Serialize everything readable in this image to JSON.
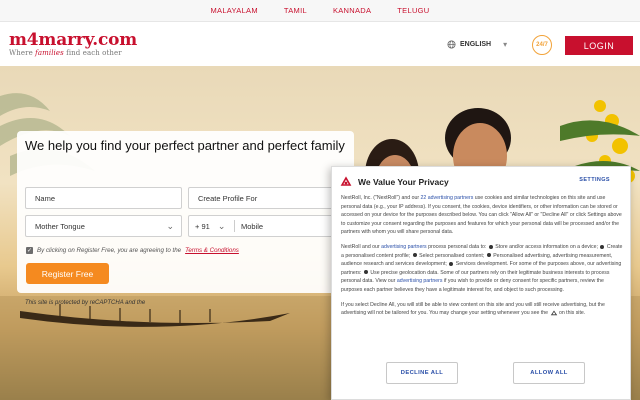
{
  "languages": [
    "MALAYALAM",
    "TAMIL",
    "KANNADA",
    "TELUGU"
  ],
  "header": {
    "logo": "m4marry.com",
    "tagline_pre": "Where ",
    "tagline_em": "families",
    "tagline_post": " find each other",
    "language": "ENGLISH",
    "support_label": "24/7",
    "login_label": "LOGIN"
  },
  "registration": {
    "title": "We help you find your perfect partner and perfect family",
    "name_placeholder": "Name",
    "profile_for_placeholder": "Create Profile For",
    "mother_tongue_placeholder": "Mother Tongue",
    "country_code": "+ 91",
    "mobile_placeholder": "Mobile",
    "consent_pre": "By clicking on Register Free, you are agreeing to the",
    "consent_link": "Terms & Conditions",
    "register_label": "Register Free",
    "recaptcha_note": "This site is protected by reCAPTCHA and the"
  },
  "privacy_modal": {
    "title": "We Value Your Privacy",
    "settings_label": "SETTINGS",
    "p1_a": "NextRoll, Inc. (\"NextRoll\") and our",
    "p1_link": "22 advertising partners",
    "p1_b": "use cookies and similar technologies on this site and use personal data (e.g., your IP address). If you consent, the cookies, device identifiers, or other information can be stored or accessed on your device for the purposes described below. You can click \"Allow All\" or \"Decline All\" or click Settings above to customize your consent regarding the purposes and features for which your personal data will be processed and/or the partners with whom you will share personal data.",
    "p2_a": "NextRoll and our",
    "p2_link": "advertising partners",
    "p2_b": "process personal data to:",
    "p2_items": [
      "Store and/or access information on a device;",
      "Create a personalised content profile;",
      "Select personalised content;",
      "Personalised advertising, advertising measurement, audience research and services development;",
      "Services development. For some of the purposes above, our advertising partners:",
      "Use precise geolocation data."
    ],
    "p2_c": "Some of our partners rely on their legitimate business interests to process personal data. View our",
    "p2_link2": "advertising partners",
    "p2_d": "if you wish to provide or deny consent for specific partners, review the purposes each partner believes they have a legitimate interest for, and object to such processing.",
    "p3_a": "If you select Decline All, you will still be able to view content on this site and you will still receive advertising, but the advertising will not be tailored for you. You may change your setting whenever you see the",
    "p3_b": "on this site.",
    "decline_label": "DECLINE ALL",
    "allow_label": "ALLOW ALL"
  },
  "colors": {
    "brand_red": "#c8102e",
    "register_orange": "#f58a1f",
    "link_blue": "#2a4fa8"
  }
}
